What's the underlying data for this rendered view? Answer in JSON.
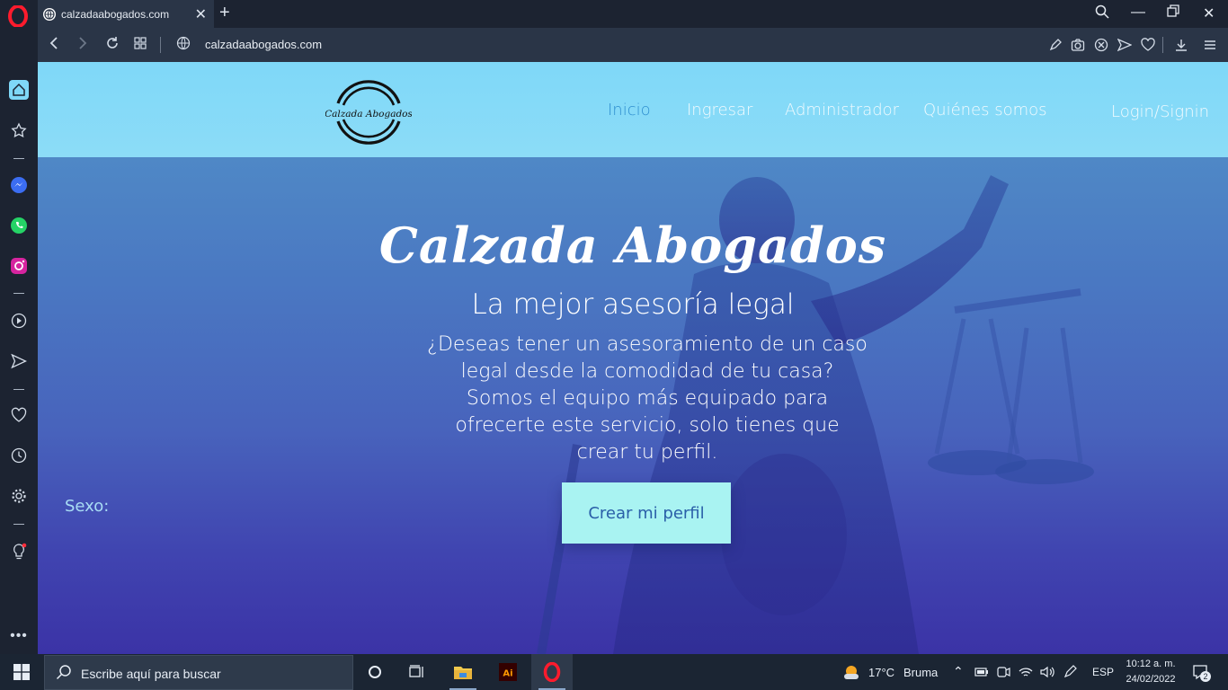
{
  "browser": {
    "tab_title": "calzadaabogados.com",
    "url": "calzadaabogados.com"
  },
  "site": {
    "logo_text": "Calzada Abogados",
    "nav": {
      "inicio": "Inicio",
      "ingresar": "Ingresar",
      "administrador": "Administrador",
      "quienes": "Quiénes somos",
      "login": "Login/Signin"
    },
    "hero": {
      "title": "Calzada Abogados",
      "subtitle": "La mejor asesoría legal",
      "text": "¿Deseas tener un asesoramiento de un caso legal desde la comodidad de tu casa? Somos el equipo más equipado para ofrecerte este servicio, solo tienes que crear tu perfil.",
      "cta": "Crear mi perfil",
      "sexo_label": "Sexo:"
    }
  },
  "taskbar": {
    "search_placeholder": "Escribe aquí para buscar",
    "weather_temp": "17°C",
    "weather_desc": "Bruma",
    "language": "ESP",
    "time": "10:12 a. m.",
    "date": "24/02/2022",
    "notifications": "2",
    "apps": [
      "cortana-icon",
      "task-view-icon",
      "file-explorer-icon",
      "illustrator-icon",
      "opera-icon"
    ]
  },
  "colors": {
    "header_bg": "#8cdcf7",
    "nav_active": "#2f8fd0",
    "cta_bg": "#a9f3f2",
    "cta_text": "#2a5fa8"
  }
}
